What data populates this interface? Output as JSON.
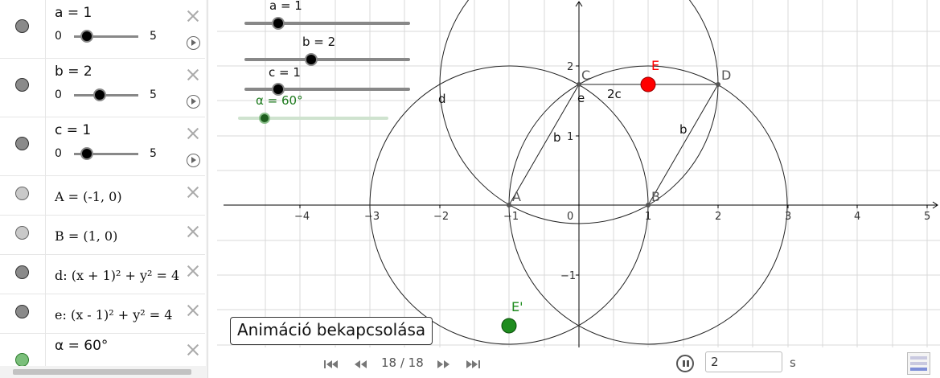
{
  "algebra": {
    "rows": [
      {
        "id": "a",
        "label": "a = 1",
        "min": "0",
        "max": "5",
        "value": 1,
        "range": [
          0,
          5
        ]
      },
      {
        "id": "b",
        "label": "b = 2",
        "min": "0",
        "max": "5",
        "value": 2,
        "range": [
          0,
          5
        ]
      },
      {
        "id": "c",
        "label": "c = 1",
        "min": "0",
        "max": "5",
        "value": 1,
        "range": [
          0,
          5
        ]
      }
    ],
    "point_A": "A = (-1, 0)",
    "point_B": "B = (1, 0)",
    "circle_d": "d: (x + 1)² + y² = 4",
    "circle_e": "e: (x - 1)² + y² = 4",
    "alpha": "α = 60°"
  },
  "graphics": {
    "sliders": [
      {
        "label": "a = 1",
        "value": 1,
        "range": [
          0,
          5
        ],
        "color": "#000000"
      },
      {
        "label": "b = 2",
        "value": 2,
        "range": [
          0,
          5
        ],
        "color": "#000000"
      },
      {
        "label": "c = 1",
        "value": 1,
        "range": [
          0,
          5
        ],
        "color": "#000000"
      },
      {
        "label": "α = 60°",
        "value": 60,
        "range": [
          0,
          360
        ],
        "color": "#1e7b1e"
      }
    ],
    "x_ticks": [
      "−4",
      "−3",
      "−2",
      "−1",
      "0",
      "1",
      "2",
      "3",
      "4",
      "5"
    ],
    "y_ticks": [
      "2",
      "1",
      "−1"
    ],
    "points": {
      "A": "A",
      "B": "B",
      "C": "C",
      "D": "D",
      "E": "E",
      "E_prime": "E'"
    },
    "segment_labels": {
      "b_left": "b",
      "b_right": "b",
      "two_c": "2c",
      "d": "d",
      "e": "e"
    },
    "animation_button": "Animáció bekapcsolása",
    "colors": {
      "E": "#ff0000",
      "E_prime": "#1e8c1e",
      "alpha": "#1e7b1e",
      "axes": "#000000",
      "grid": "#d9d9d9"
    }
  },
  "toolbar": {
    "step": "18 / 18",
    "speed": "2",
    "speed_unit": "s",
    "icons": [
      "first-step-icon",
      "prev-step-icon",
      "next-step-icon",
      "last-step-icon",
      "pause-icon"
    ]
  }
}
